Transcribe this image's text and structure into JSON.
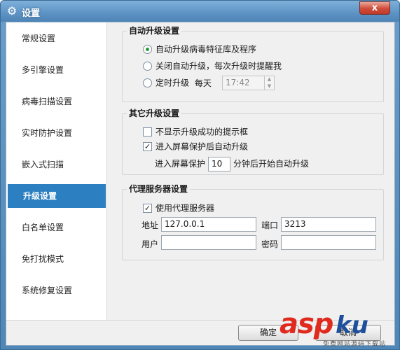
{
  "window": {
    "title": "设置",
    "icon": "gear-icon",
    "close_label": "x"
  },
  "sidebar": {
    "items": [
      {
        "label": "常规设置",
        "active": false
      },
      {
        "label": "多引擎设置",
        "active": false
      },
      {
        "label": "病毒扫描设置",
        "active": false
      },
      {
        "label": "实时防护设置",
        "active": false
      },
      {
        "label": "嵌入式扫描",
        "active": false
      },
      {
        "label": "升级设置",
        "active": true
      },
      {
        "label": "白名单设置",
        "active": false
      },
      {
        "label": "免打扰模式",
        "active": false
      },
      {
        "label": "系统修复设置",
        "active": false
      }
    ]
  },
  "auto_update": {
    "title": "自动升级设置",
    "options": [
      {
        "label": "自动升级病毒特征库及程序",
        "checked": true
      },
      {
        "label": "关闭自动升级，每次升级时提醒我",
        "checked": false
      },
      {
        "label": "定时升级",
        "checked": false
      }
    ],
    "schedule_prefix": "每天",
    "schedule_time": "17:42"
  },
  "other_update": {
    "title": "其它升级设置",
    "hide_success_label": "不显示升级成功的提示框",
    "hide_success_checked": false,
    "screensaver_label": "进入屏幕保护后自动升级",
    "screensaver_checked": true,
    "delay_prefix": "进入屏幕保护",
    "delay_value": "10",
    "delay_suffix": "分钟后开始自动升级"
  },
  "proxy": {
    "title": "代理服务器设置",
    "use_proxy_label": "使用代理服务器",
    "use_proxy_checked": true,
    "address_label": "地址",
    "address_value": "127.0.0.1",
    "port_label": "端口",
    "port_value": "3213",
    "user_label": "用户",
    "user_value": "",
    "password_label": "密码",
    "password_value": ""
  },
  "footer": {
    "ok_label": "确定",
    "cancel_label": "取消"
  },
  "watermark": {
    "brand_a": "asp",
    "brand_b": "ku",
    "tagline": "免费网站源码下载站"
  },
  "colors": {
    "accent": "#2c7fc0",
    "radio_dot": "#2a9a3a",
    "watermark_red": "#e02a1e",
    "watermark_blue": "#1d4f9c"
  }
}
